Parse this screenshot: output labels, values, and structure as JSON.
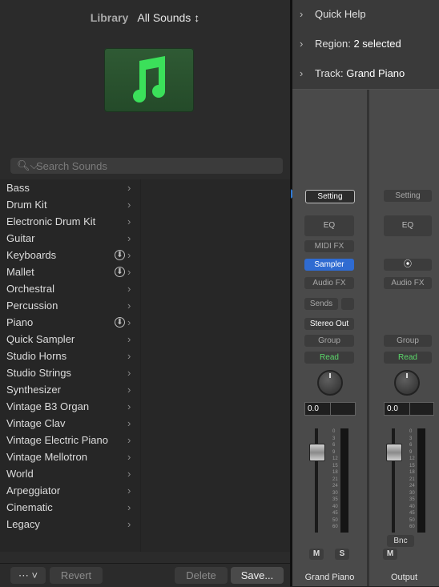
{
  "library": {
    "label": "Library",
    "selector": "All Sounds ↕",
    "search_placeholder": "Search Sounds",
    "categories": [
      {
        "name": "Bass",
        "download": false
      },
      {
        "name": "Drum Kit",
        "download": false
      },
      {
        "name": "Electronic Drum Kit",
        "download": false
      },
      {
        "name": "Guitar",
        "download": false
      },
      {
        "name": "Keyboards",
        "download": true
      },
      {
        "name": "Mallet",
        "download": true
      },
      {
        "name": "Orchestral",
        "download": false
      },
      {
        "name": "Percussion",
        "download": false
      },
      {
        "name": "Piano",
        "download": true
      },
      {
        "name": "Quick Sampler",
        "download": false
      },
      {
        "name": "Studio Horns",
        "download": false
      },
      {
        "name": "Studio Strings",
        "download": false
      },
      {
        "name": "Synthesizer",
        "download": false
      },
      {
        "name": "Vintage B3 Organ",
        "download": false
      },
      {
        "name": "Vintage Clav",
        "download": false
      },
      {
        "name": "Vintage Electric Piano",
        "download": false
      },
      {
        "name": "Vintage Mellotron",
        "download": false
      },
      {
        "name": "World",
        "download": false
      },
      {
        "name": "Arpeggiator",
        "download": false
      },
      {
        "name": "Cinematic",
        "download": false
      },
      {
        "name": "Legacy",
        "download": false
      }
    ],
    "footer": {
      "action_menu": "⋯ ˅",
      "revert": "Revert",
      "delete": "Delete",
      "save": "Save..."
    }
  },
  "inspector": {
    "quick_help": "Quick Help",
    "region_label": "Region:",
    "region_value": "2 selected",
    "track_label": "Track:",
    "track_value": "Grand Piano",
    "strip1": {
      "setting": "Setting",
      "eq": "EQ",
      "midi_fx": "MIDI FX",
      "instrument": "Sampler",
      "audio_fx": "Audio FX",
      "sends": "Sends",
      "output": "Stereo Out",
      "group": "Group",
      "automation": "Read",
      "volume": "0.0",
      "mute": "M",
      "solo": "S",
      "name": "Grand Piano"
    },
    "strip2": {
      "setting": "Setting",
      "eq": "EQ",
      "link_icon": "stereo-link-icon",
      "audio_fx": "Audio FX",
      "group": "Group",
      "automation": "Read",
      "volume": "0.0",
      "bounce": "Bnc",
      "mute": "M",
      "name": "Output"
    },
    "meter_scale": [
      "0",
      "3",
      "6",
      "9",
      "12",
      "15",
      "18",
      "21",
      "24",
      "30",
      "35",
      "40",
      "45",
      "50",
      "60"
    ]
  },
  "colors": {
    "accent_blue": "#2f6bd1",
    "read_green": "#5bd76a",
    "patch_icon_green": "#3be05a"
  }
}
